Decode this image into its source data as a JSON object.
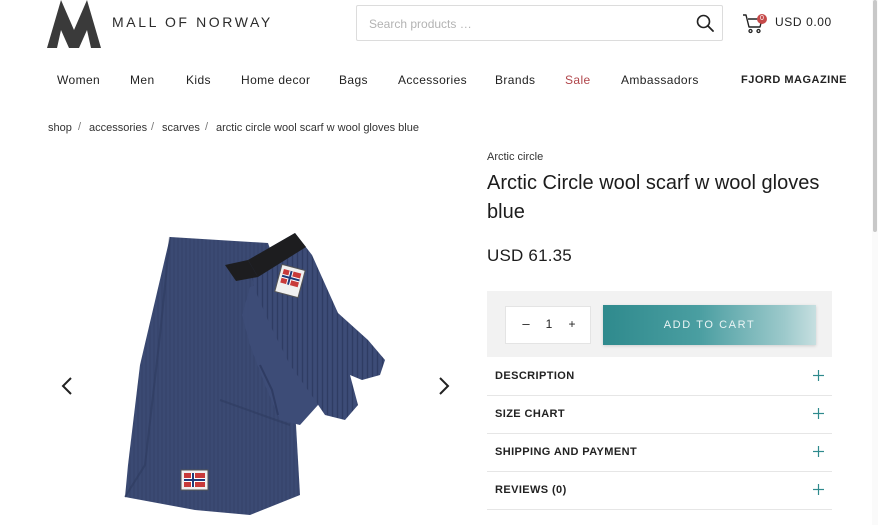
{
  "header": {
    "logo_text": "MALL OF NORWAY",
    "search_placeholder": "Search products …",
    "cart_count": "0",
    "cart_total": "USD 0.00"
  },
  "nav": {
    "items": [
      {
        "label": "Women"
      },
      {
        "label": "Men"
      },
      {
        "label": "Kids"
      },
      {
        "label": "Home decor"
      },
      {
        "label": "Bags"
      },
      {
        "label": "Accessories"
      },
      {
        "label": "Brands"
      },
      {
        "label": "Sale"
      },
      {
        "label": "Ambassadors"
      }
    ],
    "magazine": "FJORD MAGAZINE"
  },
  "breadcrumb": [
    "shop",
    "accessories",
    "scarves",
    "arctic circle wool scarf w wool gloves blue"
  ],
  "breadcrumb_separator": "/",
  "product": {
    "brand": "Arctic circle",
    "title": "Arctic Circle wool scarf w wool gloves blue",
    "price": "USD 61.35",
    "quantity": "1",
    "qty_minus": "–",
    "qty_plus": "+",
    "add_to_cart": "ADD TO CART",
    "image_colors": {
      "scarf": "#3b4a73",
      "glove": "#3d4c77",
      "cuff": "#1d1d1f"
    }
  },
  "accordion": [
    {
      "label": "DESCRIPTION"
    },
    {
      "label": "SIZE CHART"
    },
    {
      "label": "SHIPPING AND PAYMENT"
    },
    {
      "label": "REVIEWS (0)"
    }
  ],
  "colors": {
    "accent": "#2f8a8d",
    "sale": "#b0454a"
  }
}
